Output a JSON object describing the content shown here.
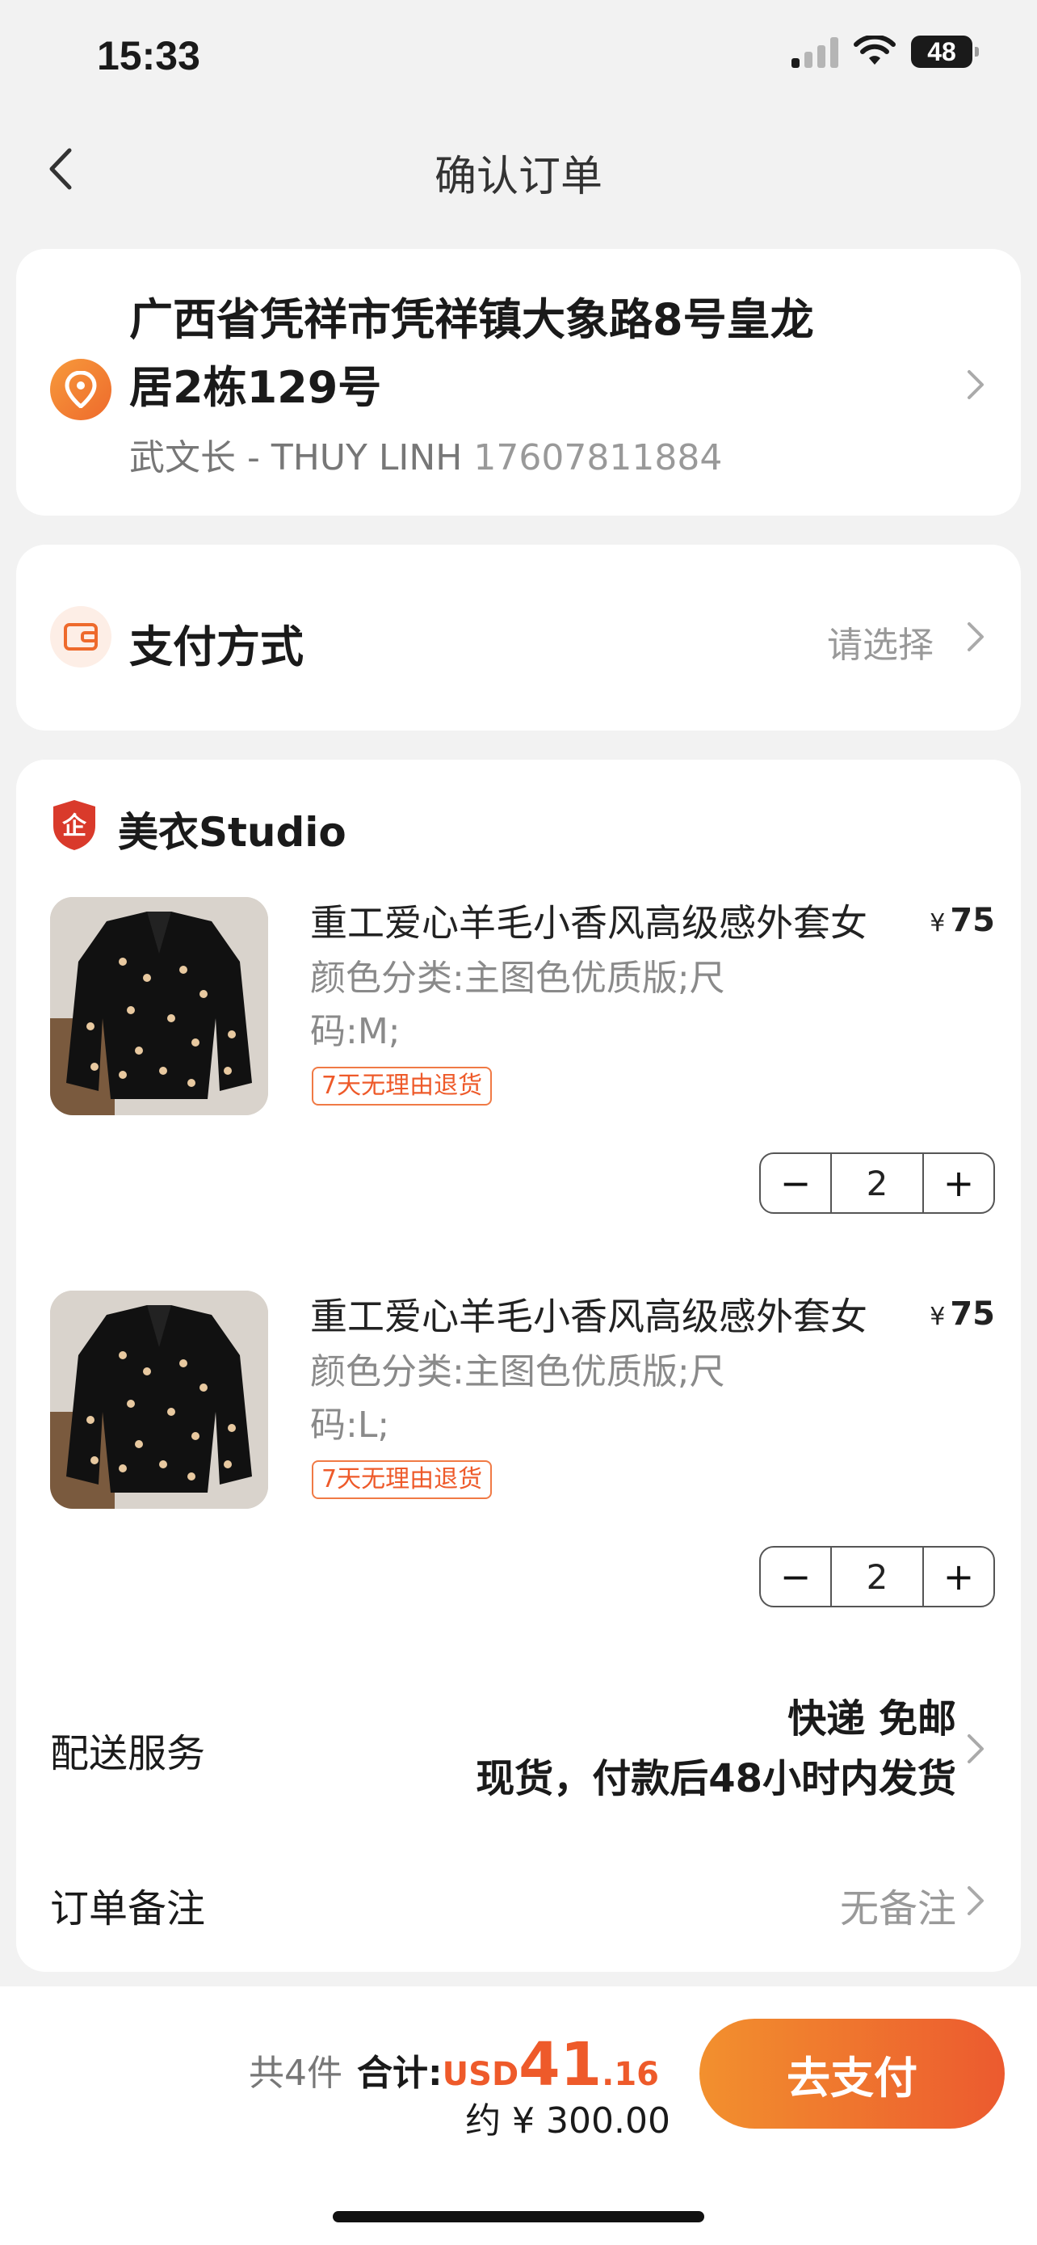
{
  "status_bar": {
    "time": "15:33",
    "battery": "48"
  },
  "nav": {
    "title": "确认订单"
  },
  "address": {
    "line1": "广西省凭祥市凭祥镇大象路8号皇龙",
    "line2": "居2栋129号",
    "contact_name": "武文长 - THUY LINH",
    "phone": "17607811884"
  },
  "payment": {
    "label": "支付方式",
    "value": "请选择"
  },
  "store": {
    "name": "美衣Studio",
    "badge_char": "企",
    "products": [
      {
        "title": "重工爱心羊毛小香风高级感外套女",
        "spec_line1": "颜色分类:主图色优质版;尺",
        "spec_line2": "码:M;",
        "tag": "7天无理由退货",
        "price_symbol": "¥",
        "price": "75",
        "minus": "−",
        "quantity": "2",
        "plus": "+"
      },
      {
        "title": "重工爱心羊毛小香风高级感外套女",
        "spec_line1": "颜色分类:主图色优质版;尺",
        "spec_line2": "码:L;",
        "tag": "7天无理由退货",
        "price_symbol": "¥",
        "price": "75",
        "minus": "−",
        "quantity": "2",
        "plus": "+"
      }
    ],
    "shipping": {
      "label": "配送服务",
      "line1": "快递 免邮",
      "line2": "现货，付款后48小时内发货"
    },
    "note": {
      "label": "订单备注",
      "value": "无备注"
    }
  },
  "bottom": {
    "count": "共4件",
    "total_label": "合计:",
    "currency": "USD",
    "amount_int": "41",
    "amount_dec": ".16",
    "approx": "约 ¥ 300.00",
    "pay_button": "去支付"
  },
  "colors": {
    "accent": "#ec5a2f",
    "accent_light": "#f2902e",
    "background": "#f2f2f2"
  }
}
